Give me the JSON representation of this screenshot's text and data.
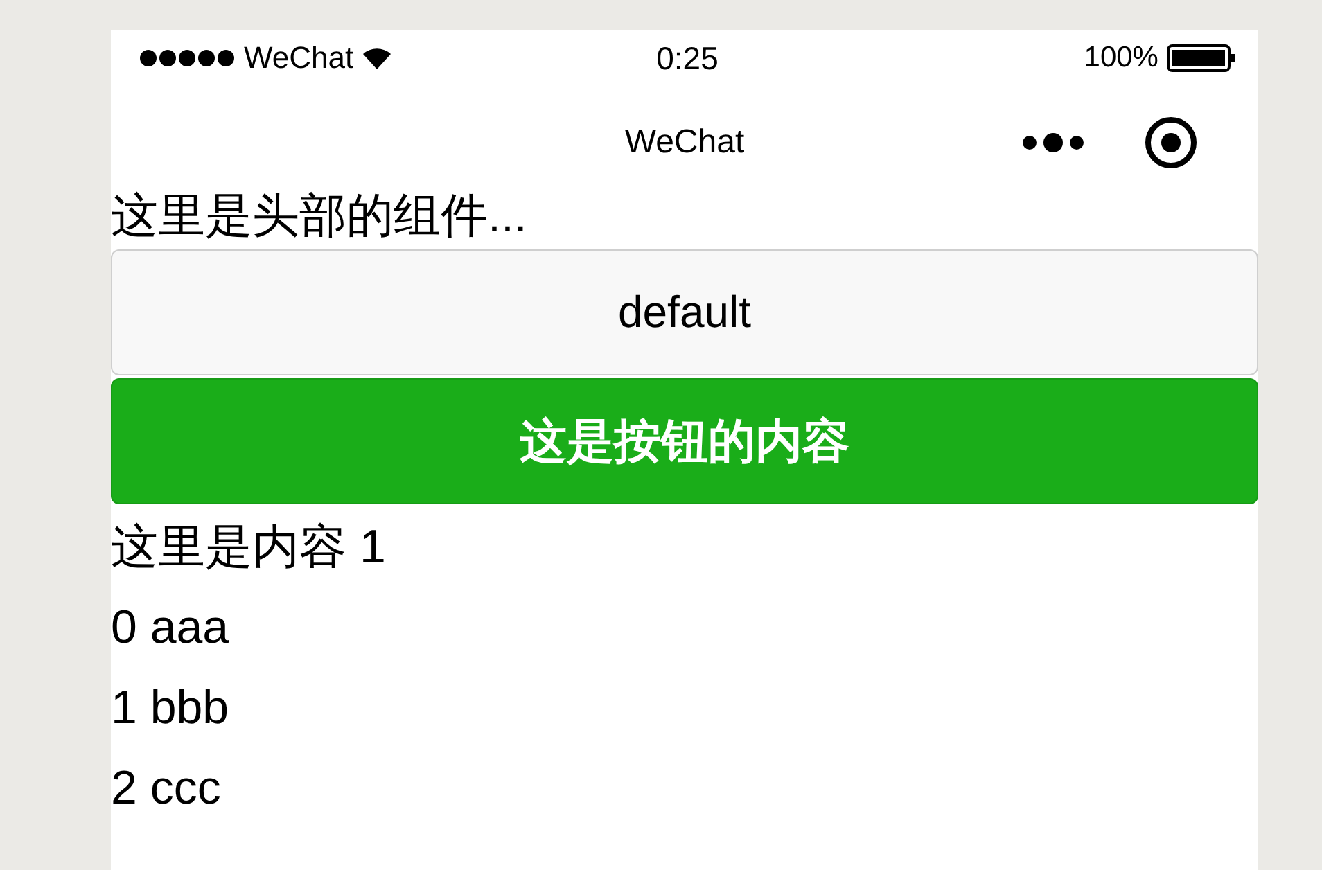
{
  "status_bar": {
    "carrier": "WeChat",
    "time": "0:25",
    "battery": "100%"
  },
  "nav_bar": {
    "title": "WeChat"
  },
  "header": "这里是头部的组件...",
  "buttons": [
    {
      "label": "default",
      "kind": "default"
    },
    {
      "label": "这是按钮的内容",
      "kind": "primary"
    }
  ],
  "content_title": "这里是内容 1",
  "items": [
    "0 aaa",
    "1 bbb",
    "2 ccc"
  ]
}
